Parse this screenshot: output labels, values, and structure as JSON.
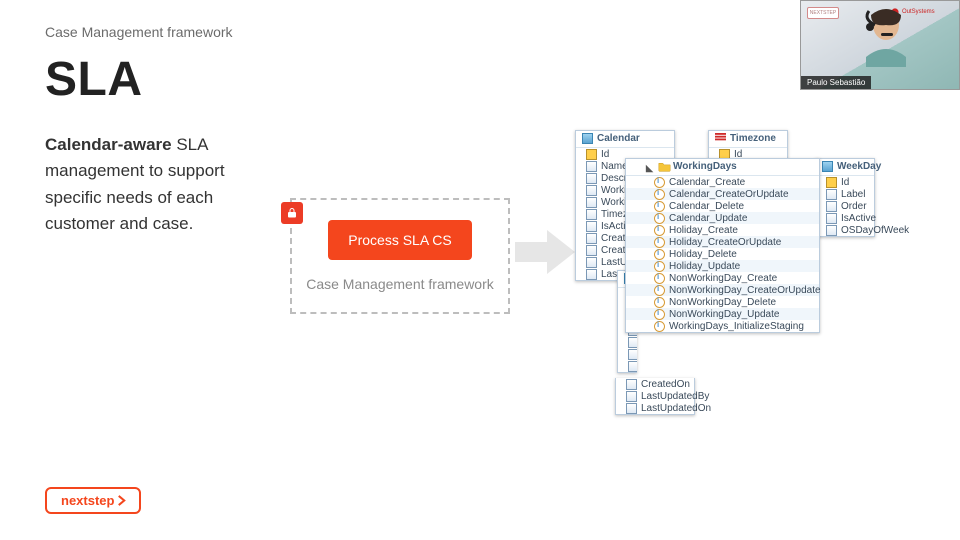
{
  "header": "Case Management framework",
  "title": "SLA",
  "desc_bold": "Calendar-aware",
  "desc_rest": " SLA management to support specific needs of each customer and case.",
  "diagram": {
    "button": "Process SLA CS",
    "label": "Case Management framework"
  },
  "panels": {
    "calendar": {
      "title": "Calendar",
      "rows": [
        "Id",
        "Name",
        "Description",
        "WorkingHourStart",
        "WorkingHourEnd",
        "TimezoneId",
        "IsActive",
        "CreatedBy",
        "CreatedOn",
        "LastUpdatedBy",
        "LastUpdatedOn"
      ]
    },
    "timezone": {
      "title": "Timezone",
      "rows": [
        "Id"
      ]
    },
    "weekday": {
      "title": "WeekDay",
      "rows": [
        "Id",
        "Label",
        "Order",
        "IsActive",
        "OSDayOfWeek"
      ]
    },
    "working": {
      "title": "WorkingDays",
      "rows": [
        "Calendar_Create",
        "Calendar_CreateOrUpdate",
        "Calendar_Delete",
        "Calendar_Update",
        "Holiday_Create",
        "Holiday_CreateOrUpdate",
        "Holiday_Delete",
        "Holiday_Update",
        "NonWorkingDay_Create",
        "NonWorkingDay_CreateOrUpdate",
        "NonWorkingDay_Delete",
        "NonWorkingDay_Update",
        "WorkingDays_InitializeStaging"
      ]
    },
    "tail": {
      "rows": [
        "CreatedOn",
        "LastUpdatedBy",
        "LastUpdatedOn"
      ]
    }
  },
  "logo": "nextstep",
  "presenter": "Paulo Sebastião",
  "badge_text": "OutSystems",
  "tinybox_text": "NEXTSTEP"
}
